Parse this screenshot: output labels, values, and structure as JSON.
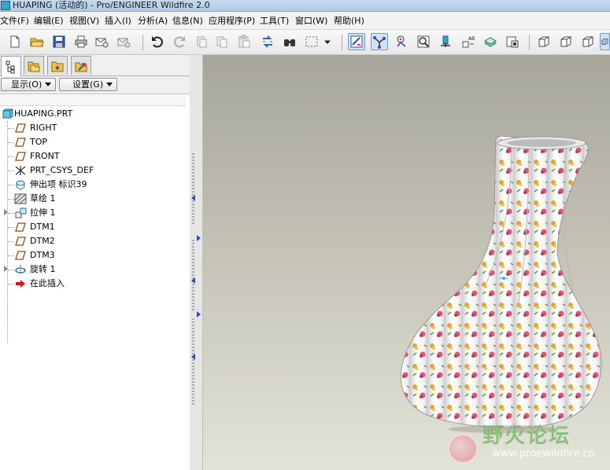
{
  "window": {
    "title": "HUAPING (活动的) - Pro/ENGINEER Wildfire 2.0"
  },
  "menu": [
    "文件(F)",
    "编辑(E)",
    "视图(V)",
    "插入(I)",
    "分析(A)",
    "信息(N)",
    "应用程序(P)",
    "工具(T)",
    "窗口(W)",
    "帮助(H)"
  ],
  "toolbar": {
    "icons": [
      "new-file-icon",
      "open-file-icon",
      "save-icon",
      "print-icon",
      "send-mail-icon",
      "mail-attach-icon",
      "undo-icon",
      "redo-icon",
      "cut-icon",
      "copy-icon",
      "paste-icon",
      "paste-special-icon",
      "regenerate-icon",
      "find-icon",
      "select-box-icon",
      "dropdown-arrow-icon",
      "datum-planes-icon",
      "datum-axes-icon",
      "datum-points-icon",
      "zoom-box-icon",
      "zoom-in-icon",
      "annotation-icon",
      "layers-icon",
      "saved-views-icon",
      "wireframe-cube-icon",
      "hidden-line-cube-icon",
      "no-hidden-cube-icon",
      "shaded-cube-icon"
    ]
  },
  "panel": {
    "show_button": "显示(O)",
    "settings_button": "设置(G)"
  },
  "tree": {
    "root": "HUAPING.PRT",
    "items": [
      {
        "label": "RIGHT",
        "icon": "datum-plane-icon"
      },
      {
        "label": "TOP",
        "icon": "datum-plane-icon"
      },
      {
        "label": "FRONT",
        "icon": "datum-plane-icon"
      },
      {
        "label": "PRT_CSYS_DEF",
        "icon": "coordinate-system-icon"
      },
      {
        "label": "伸出项 标识39",
        "icon": "protrusion-icon"
      },
      {
        "label": "草绘 1",
        "icon": "sketch-icon"
      },
      {
        "label": "拉伸 1",
        "icon": "extrude-icon"
      },
      {
        "label": "DTM1",
        "icon": "datum-plane-icon"
      },
      {
        "label": "DTM2",
        "icon": "datum-plane-icon"
      },
      {
        "label": "DTM3",
        "icon": "datum-plane-icon"
      },
      {
        "label": "旋转 1",
        "icon": "revolve-icon"
      },
      {
        "label": "在此插入",
        "icon": "insert-here-arrow-icon"
      }
    ]
  },
  "watermark": {
    "title": "野火论坛",
    "url": "www.proewildfire.cn"
  },
  "colors": {
    "accent": "#2d4fb3",
    "titlebar": "#b3c9e3",
    "viewport_top": "#a6a59c",
    "viewport_bottom": "#e3e3d9",
    "insert_arrow": "#c81818"
  }
}
